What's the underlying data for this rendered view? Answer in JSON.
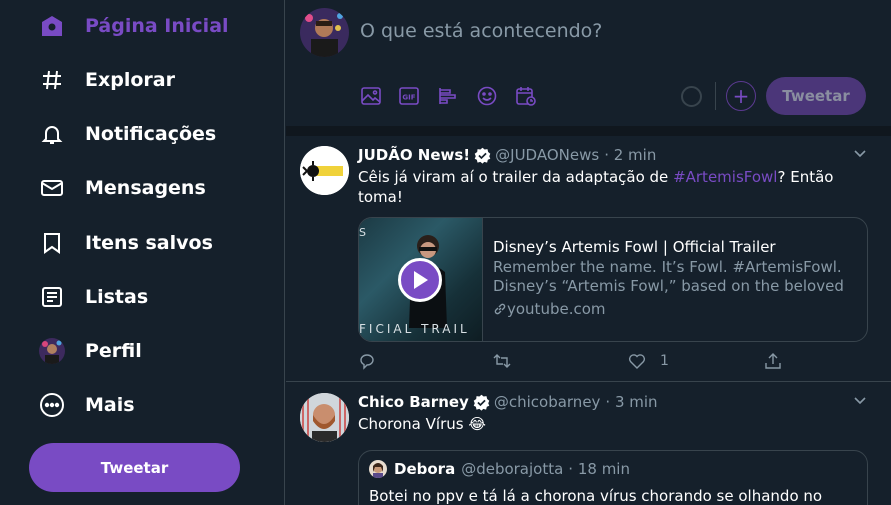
{
  "sidebar": {
    "items": [
      {
        "label": "Página Inicial",
        "icon": "home-icon",
        "active": true
      },
      {
        "label": "Explorar",
        "icon": "hashtag-icon"
      },
      {
        "label": "Notificações",
        "icon": "bell-icon"
      },
      {
        "label": "Mensagens",
        "icon": "envelope-icon"
      },
      {
        "label": "Itens salvos",
        "icon": "bookmark-icon"
      },
      {
        "label": "Listas",
        "icon": "list-icon"
      },
      {
        "label": "Perfil",
        "icon": "avatar"
      },
      {
        "label": "Mais",
        "icon": "more-circle-icon"
      }
    ],
    "tweet_button": "Tweetar"
  },
  "compose": {
    "placeholder": "O que está acontecendo?",
    "tools": [
      "image-icon",
      "gif-icon",
      "poll-icon",
      "emoji-icon",
      "schedule-icon"
    ],
    "submit_label": "Tweetar",
    "add_icon": "+"
  },
  "timeline": {
    "tweets": [
      {
        "name": "JUDÃO News!",
        "handle": "@JUDAONews",
        "time": "· 2 min",
        "text_before": "Cêis já viram aí o trailer da adaptação de ",
        "hashtag": "#ArtemisFowl",
        "text_after": "? Então toma!",
        "card": {
          "title": "Disney’s Artemis Fowl | Official Trailer",
          "description": "Remember the name. It’s Fowl. #ArtemisFowl. Disney’s “Artemis Fowl,” based on the beloved",
          "domain": "youtube.com",
          "image_caption": "FICIAL TRAIL",
          "image_top_caption": "S"
        },
        "likes": "1"
      },
      {
        "name": "Chico Barney",
        "handle": "@chicobarney",
        "time": "· 3 min",
        "text": "Chorona Vírus 😂",
        "quote": {
          "name": "Debora",
          "handle": "@deborajotta",
          "time": "· 18 min",
          "text": "Botei no ppv e tá lá a chorona vírus chorando se olhando no"
        }
      }
    ]
  },
  "colors": {
    "background": "#15202b",
    "accent": "#794bc4",
    "muted": "#8899a6",
    "border": "#38444d"
  }
}
